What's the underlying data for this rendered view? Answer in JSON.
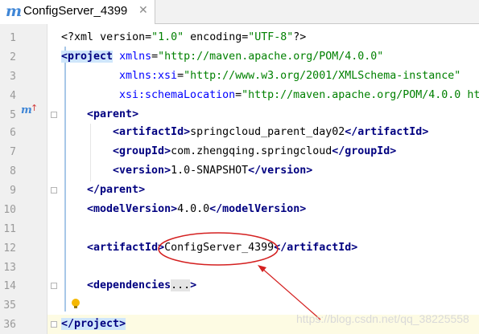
{
  "tab": {
    "title": "ConfigServer_4399",
    "icon": "maven-m-icon",
    "close": "✕"
  },
  "watermark": "https://blog.csdn.net/qq_38225558",
  "lines": [
    {
      "num": "1",
      "text": "<?xml version=\"1.0\" encoding=\"UTF-8\"?>"
    },
    {
      "num": "2",
      "text": "<project xmlns=\"http://maven.apache.org/POM/4.0.0\""
    },
    {
      "num": "3",
      "text": "xmlns:xsi=\"http://www.w3.org/2001/XMLSchema-instance\""
    },
    {
      "num": "4",
      "text": "xsi:schemaLocation=\"http://maven.apache.org/POM/4.0.0 ht"
    },
    {
      "num": "5",
      "text": "<parent>"
    },
    {
      "num": "6",
      "text": "<artifactId>springcloud_parent_day02</artifactId>"
    },
    {
      "num": "7",
      "text": "<groupId>com.zhengqing.springcloud</groupId>"
    },
    {
      "num": "8",
      "text": "<version>1.0-SNAPSHOT</version>"
    },
    {
      "num": "9",
      "text": "</parent>"
    },
    {
      "num": "10",
      "text": "<modelVersion>4.0.0</modelVersion>"
    },
    {
      "num": "11",
      "text": ""
    },
    {
      "num": "12",
      "text": "<artifactId>ConfigServer_4399</artifactId>"
    },
    {
      "num": "13",
      "text": ""
    },
    {
      "num": "14",
      "text": "<dependencies...>"
    },
    {
      "num": "35",
      "text": ""
    },
    {
      "num": "36",
      "text": "</project>"
    }
  ],
  "tokens": {
    "l1": {
      "lt": "<?",
      "name": "xml",
      "a1": "version",
      "v1": "\"1.0\"",
      "a2": "encoding",
      "v2": "\"UTF-8\"",
      "end": "?>"
    },
    "l2": {
      "lt": "<",
      "name": "project",
      "a1": "xmlns",
      "v1": "\"http://maven.apache.org/POM/4.0.0\""
    },
    "l3": {
      "a1": "xmlns:xsi",
      "v1": "\"http://www.w3.org/2001/XMLSchema-instance\""
    },
    "l4": {
      "a1": "xsi:schemaLocation",
      "v1": "\"http://maven.apache.org/POM/4.0.0 ht"
    },
    "l5": {
      "open": "parent"
    },
    "l6": {
      "open": "artifactId",
      "content": "springcloud_parent_day02",
      "close": "artifactId"
    },
    "l7": {
      "open": "groupId",
      "content": "com.zhengqing.springcloud",
      "close": "groupId"
    },
    "l8": {
      "open": "version",
      "content": "1.0-SNAPSHOT",
      "close": "version"
    },
    "l9": {
      "close": "parent"
    },
    "l10": {
      "open": "modelVersion",
      "content": "4.0.0",
      "close": "modelVersion"
    },
    "l12": {
      "open": "artifactId",
      "content": "ConfigServer_4399",
      "close": "artifactId"
    },
    "l14": {
      "open": "dependencies",
      "folded": "..."
    },
    "l36": {
      "close": "project"
    }
  },
  "colors": {
    "tag": "#000080",
    "attr": "#0000ff",
    "value": "#008000",
    "annotation": "#d42020"
  }
}
